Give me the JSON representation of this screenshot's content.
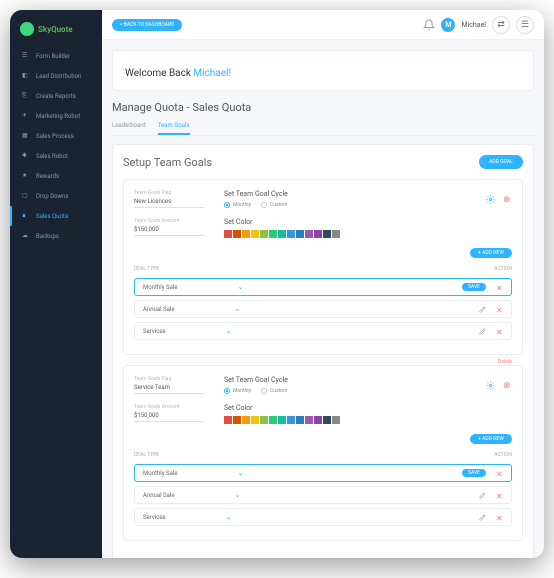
{
  "brand": "SkyQuote",
  "topbar": {
    "back": "< BACK TO DASHBOARD",
    "username": "Michael",
    "avatar_initial": "M"
  },
  "sidebar": {
    "items": [
      {
        "label": "Form Builder"
      },
      {
        "label": "Lead Distribution"
      },
      {
        "label": "Create Reports"
      },
      {
        "label": "Marketing Robot"
      },
      {
        "label": "Sales Process"
      },
      {
        "label": "Sales Robot"
      },
      {
        "label": "Rewards"
      },
      {
        "label": "Drop Downs"
      },
      {
        "label": "Sales Quota"
      },
      {
        "label": "Backups"
      }
    ],
    "active_index": 8
  },
  "welcome": {
    "prefix": "Welcome Back ",
    "name": "Michael!"
  },
  "page_title": "Manage Quota - Sales Quota",
  "tabs": [
    {
      "label": "Leaderboard"
    },
    {
      "label": "Team Goals"
    }
  ],
  "tabs_active": 1,
  "panel": {
    "title": "Setup Team Goals",
    "add_goal": "ADD GOAL"
  },
  "goals": [
    {
      "team_flag_label": "Team Goals Flag",
      "team_flag_value": "New Licences",
      "goal_amount_label": "Team Goals Amount",
      "goal_amount_value": "$150,000",
      "cycle_label": "Set Team Goal Cycle",
      "cycle_options": [
        "Monthly",
        "Custom"
      ],
      "cycle_selected": 0,
      "color_label": "Set Color",
      "add_new": "+ ADD NEW",
      "deal_type_h": "DEAL TYPE",
      "action_h": "ACTION",
      "delete_label": "",
      "deals": [
        {
          "name": "Monthly Sale",
          "active": true,
          "save": "SAVE"
        },
        {
          "name": "Annual Sale",
          "active": false
        },
        {
          "name": "Services",
          "active": false
        }
      ]
    },
    {
      "team_flag_label": "Team Goals Flag",
      "team_flag_value": "Service Team",
      "goal_amount_label": "Team Goals Amount",
      "goal_amount_value": "$150,000",
      "cycle_label": "Set Team Goal Cycle",
      "cycle_options": [
        "Monthly",
        "Custom"
      ],
      "cycle_selected": 0,
      "color_label": "Set Color",
      "add_new": "+ ADD NEW",
      "deal_type_h": "DEAL TYPE",
      "action_h": "ACTION",
      "delete_label": "Delete",
      "deals": [
        {
          "name": "Monthly Sale",
          "active": true,
          "save": "SAVE"
        },
        {
          "name": "Annual Sale",
          "active": false
        },
        {
          "name": "Services",
          "active": false
        }
      ]
    }
  ],
  "colors": [
    "#e74c3c",
    "#d35400",
    "#f39c12",
    "#f1c40f",
    "#8bc34a",
    "#2ecc71",
    "#1abc9c",
    "#3498db",
    "#2980b9",
    "#9b59b6",
    "#8e44ad",
    "#34495e",
    "#7f8c8d"
  ]
}
